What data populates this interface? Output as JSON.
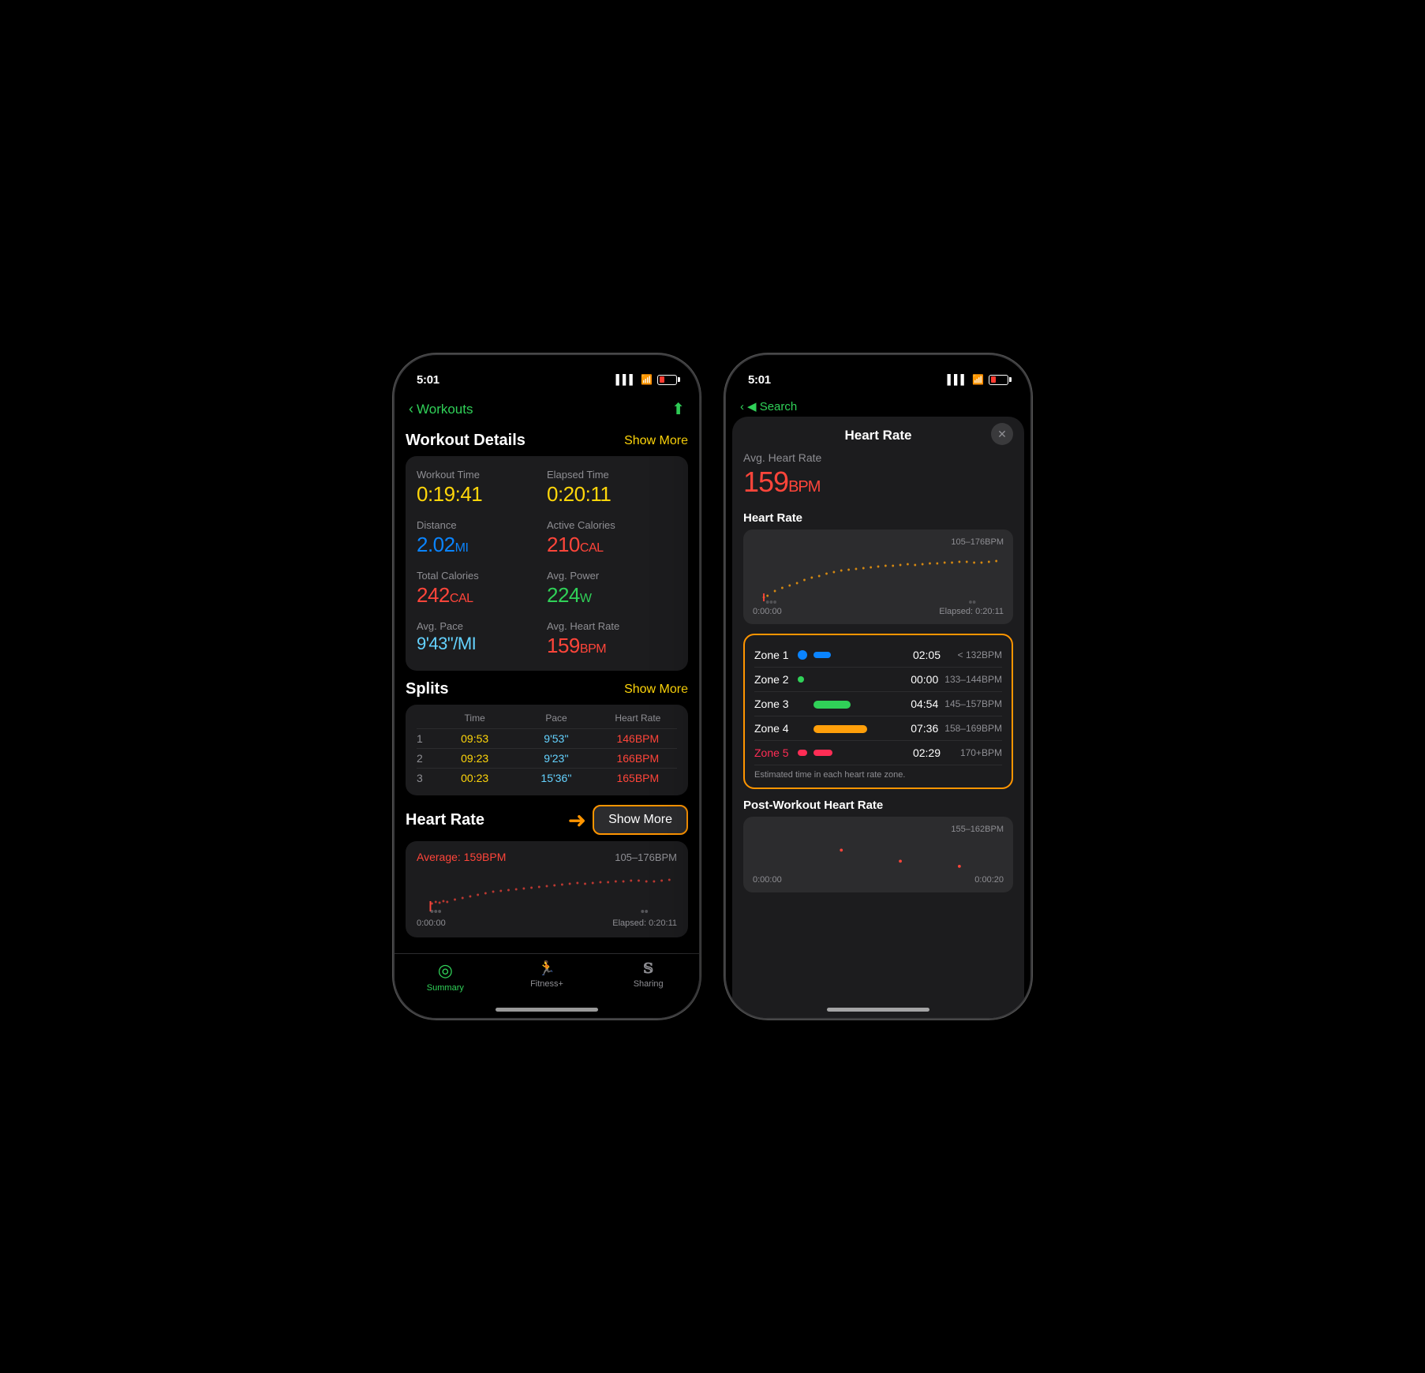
{
  "left_phone": {
    "status": {
      "time": "5:01",
      "signal": "▌▌▌",
      "wifi": "WiFi",
      "battery_level": 30
    },
    "back_nav": {
      "back_label": "◀ Search",
      "section_label": "Workouts",
      "share_icon": "⬆"
    },
    "workout_details": {
      "title": "Workout Details",
      "show_more": "Show More",
      "metrics": [
        {
          "label": "Workout Time",
          "value": "0:19:41",
          "color": "yellow"
        },
        {
          "label": "Elapsed Time",
          "value": "0:20:11",
          "color": "yellow"
        },
        {
          "label": "Distance",
          "value": "2.02",
          "unit": "MI",
          "color": "blue"
        },
        {
          "label": "Active Calories",
          "value": "210",
          "unit": "CAL",
          "color": "red"
        },
        {
          "label": "Total Calories",
          "value": "242",
          "unit": "CAL",
          "color": "red"
        },
        {
          "label": "Avg. Power",
          "value": "224",
          "unit": "W",
          "color": "green"
        },
        {
          "label": "Avg. Pace",
          "value": "9'43\"/MI",
          "color": "cyan"
        },
        {
          "label": "Avg. Heart Rate",
          "value": "159",
          "unit": "BPM",
          "color": "red"
        }
      ]
    },
    "splits": {
      "title": "Splits",
      "show_more": "Show More",
      "columns": [
        "",
        "Time",
        "Pace",
        "Heart Rate"
      ],
      "rows": [
        {
          "num": "1",
          "time": "09:53",
          "pace": "9'53''",
          "hr": "146BPM"
        },
        {
          "num": "2",
          "time": "09:23",
          "pace": "9'23''",
          "hr": "166BPM"
        },
        {
          "num": "3",
          "time": "00:23",
          "pace": "15'36''",
          "hr": "165BPM"
        }
      ]
    },
    "heart_rate": {
      "title": "Heart Rate",
      "show_more_btn": "Show More",
      "avg_label": "Average: 159BPM",
      "range": "105–176BPM",
      "elapsed": "Elapsed: 0:20:11",
      "start_time": "0:00:00"
    },
    "tabs": [
      {
        "label": "Summary",
        "icon": "◎",
        "active": true
      },
      {
        "label": "Fitness+",
        "icon": "🏃",
        "active": false
      },
      {
        "label": "Sharing",
        "icon": "S",
        "active": false
      }
    ]
  },
  "right_phone": {
    "status": {
      "time": "5:01"
    },
    "back_nav": {
      "back_label": "◀ Search"
    },
    "modal": {
      "title": "Heart Rate",
      "close_icon": "✕",
      "avg_hr": {
        "label": "Avg. Heart Rate",
        "value": "159",
        "unit": "BPM",
        "color": "#ff453a"
      },
      "hr_chart": {
        "title": "Heart Rate",
        "range": "105–176BPM",
        "elapsed": "Elapsed: 0:20:11",
        "start_time": "0:00:00"
      },
      "zones": [
        {
          "name": "Zone 1",
          "dot_color": "#0a84ff",
          "bar_color": "#0a84ff",
          "bar_width": "20%",
          "time": "02:05",
          "bpm": "< 132BPM"
        },
        {
          "name": "Zone 2",
          "dot_color": "#30d158",
          "bar_color": "#30d158",
          "bar_width": "0%",
          "time": "00:00",
          "bpm": "133–144BPM"
        },
        {
          "name": "Zone 3",
          "dot_color": "#30d158",
          "bar_color": "#30d158",
          "bar_width": "45%",
          "time": "04:54",
          "bpm": "145–157BPM"
        },
        {
          "name": "Zone 4",
          "dot_color": "#ff9f0a",
          "bar_color": "#ff9f0a",
          "bar_width": "65%",
          "time": "07:36",
          "bpm": "158–169BPM"
        },
        {
          "name": "Zone 5",
          "dot_color": "#ff2d55",
          "bar_color": "#ff2d55",
          "bar_width": "22%",
          "time": "02:29",
          "bpm": "170+BPM"
        }
      ],
      "zone_note": "Estimated time in each heart rate zone.",
      "post_workout": {
        "title": "Post-Workout Heart Rate",
        "range": "155–162BPM",
        "start_time": "0:00:00",
        "end_time": "0:00:20"
      }
    }
  }
}
